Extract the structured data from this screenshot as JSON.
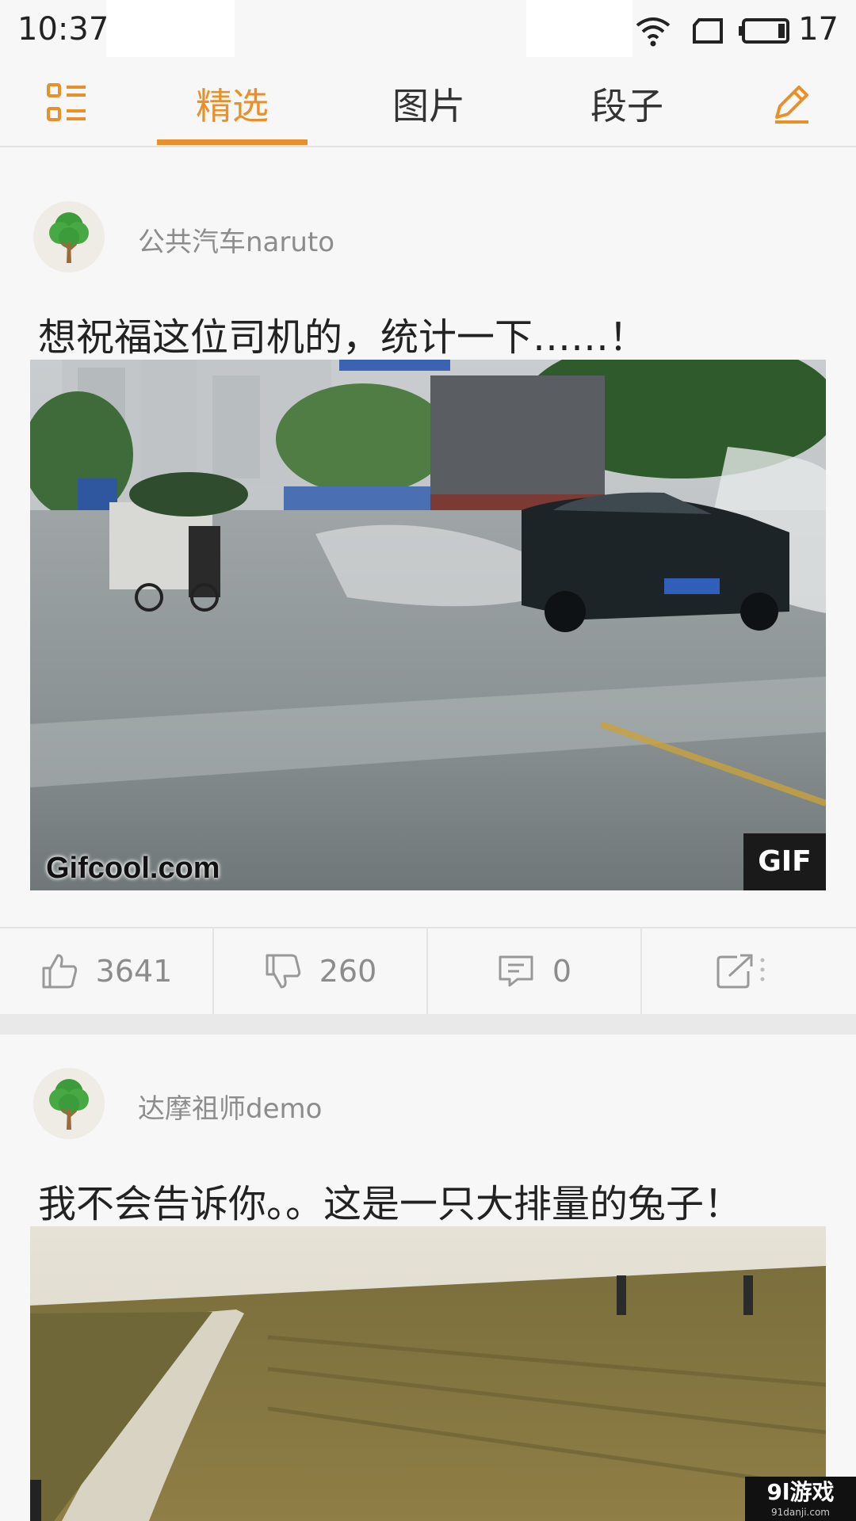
{
  "status_bar": {
    "time": "10:37",
    "battery_level": "17",
    "icons": [
      "wifi-icon",
      "sim-icon",
      "battery-icon"
    ]
  },
  "tabs": {
    "menu_icon": "menu-list-icon",
    "items": [
      {
        "label": "精选",
        "active": true
      },
      {
        "label": "图片",
        "active": false
      },
      {
        "label": "段子",
        "active": false
      }
    ],
    "edit_icon": "pencil-icon",
    "accent_color": "#e8912a"
  },
  "posts": [
    {
      "username": "公共汽车naruto",
      "text": "想祝福这位司机的，统计一下……！",
      "media_type": "gif",
      "gif_badge": "GIF",
      "watermark": "Gifcool.com",
      "likes": "3641",
      "dislikes": "260",
      "comments": "0"
    },
    {
      "username": "达摩祖师demo",
      "text": "我不会告诉你。。这是一只大排量的兔子！"
    }
  ],
  "corner_logo": {
    "title": "9l游戏",
    "url": "91danji.com"
  }
}
